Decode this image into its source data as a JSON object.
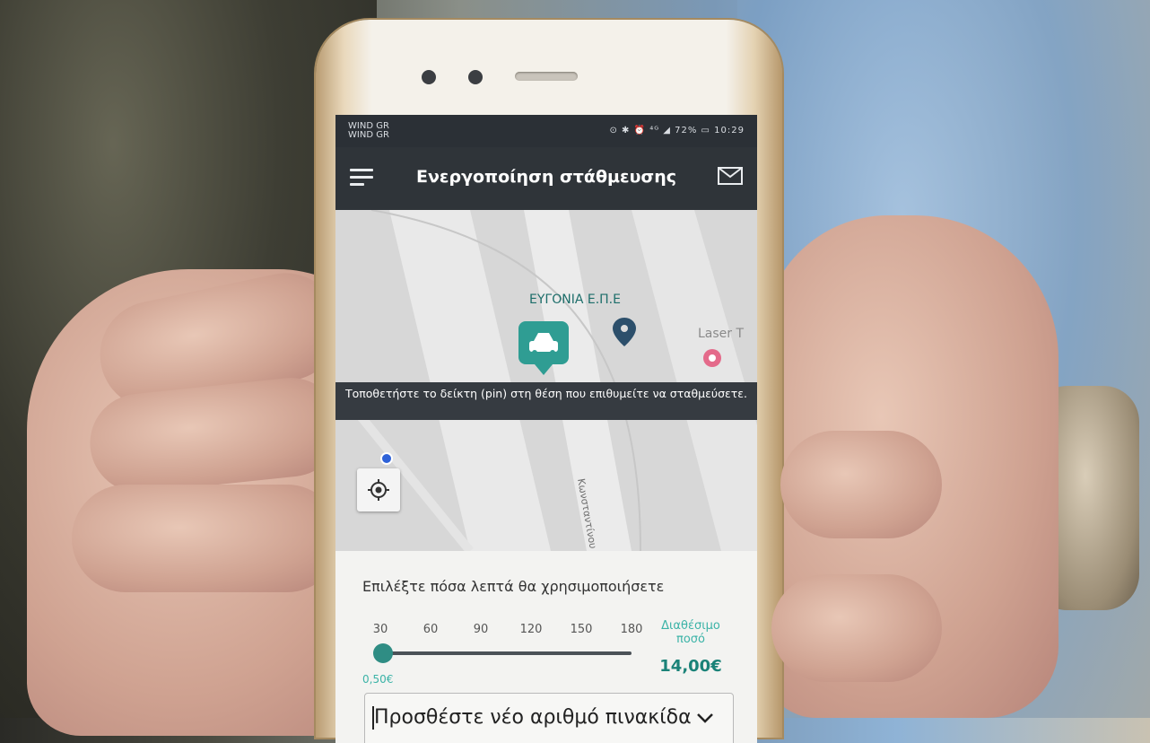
{
  "status_bar": {
    "carrier_1": "WIND GR",
    "carrier_2": "WIND GR",
    "indicators": "⊙ ✱ ⏰ ⁴ᴳ ◢ 72% ▭ 10:29"
  },
  "header": {
    "title": "Ενεργοποίηση στάθμευσης"
  },
  "map": {
    "place_label": "ΕΥΓΟΝΙΑ Ε.Π.Ε",
    "place_label_2": "Laser T",
    "street_label": "Κωνσταντίνου Βε",
    "instruction": "Τοποθετήστε το δείκτη (pin) στη θέση που επιθυμείτε να σταθμεύσετε."
  },
  "parking": {
    "prompt": "Επιλέξτε πόσα λεπτά θα χρησιμοποιήσετε",
    "ticks": [
      "30",
      "60",
      "90",
      "120",
      "150",
      "180"
    ],
    "selected_minutes": 30,
    "price": "0,50€",
    "balance_label": "Διαθέσιμο ποσό",
    "balance_value": "14,00€"
  },
  "plate": {
    "placeholder": "Προσθέστε νέο αριθμό πινακίδα"
  },
  "colors": {
    "accent": "#3bb3a7",
    "accent_dark": "#2f8d84",
    "appbar": "#2f3439"
  }
}
